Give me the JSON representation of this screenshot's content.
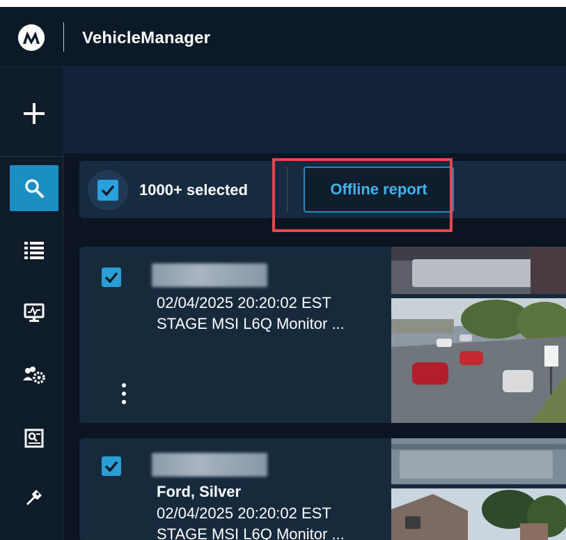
{
  "app": {
    "title": "VehicleManager",
    "logo_icon": "motorola-logo-icon"
  },
  "sidebar": {
    "items": [
      {
        "name": "add",
        "icon": "plus-icon",
        "active": false
      },
      {
        "name": "search",
        "icon": "search-icon",
        "active": true
      },
      {
        "name": "list",
        "icon": "list-icon",
        "active": false
      },
      {
        "name": "monitor",
        "icon": "monitor-icon",
        "active": false
      },
      {
        "name": "user-settings",
        "icon": "users-gear-icon",
        "active": false
      },
      {
        "name": "report",
        "icon": "report-icon",
        "active": false
      },
      {
        "name": "keys",
        "icon": "key-icon",
        "active": false
      }
    ]
  },
  "selection": {
    "count_label": "1000+ selected",
    "checked": true
  },
  "toolbar": {
    "offline_report_label": "Offline report"
  },
  "results": [
    {
      "checked": true,
      "vehicle": "",
      "timestamp": "02/04/2025 20:20:02 EST",
      "camera": "STAGE MSI L6Q Monitor ..."
    },
    {
      "checked": true,
      "vehicle": "Ford, Silver",
      "timestamp": "02/04/2025 20:20:02 EST",
      "camera": "STAGE MSI L6Q Monitor ..."
    }
  ],
  "colors": {
    "accent": "#2aa0dc",
    "link": "#3fb4ee",
    "highlight": "#e9454d",
    "topbar_bg": "#0c1926",
    "card_bg": "#17293d"
  }
}
